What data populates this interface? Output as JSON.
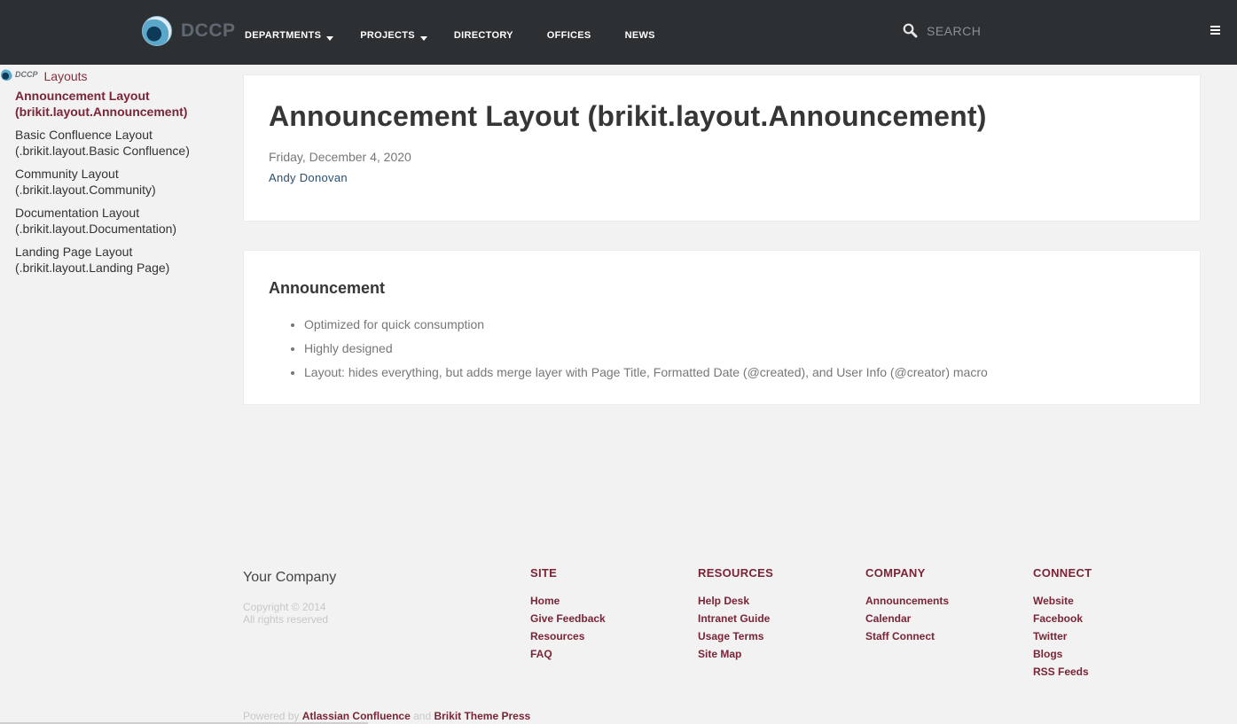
{
  "topbar": {
    "brand": "DCCP",
    "nav": [
      {
        "label": "DEPARTMENTS",
        "dropdown": true
      },
      {
        "label": "PROJECTS",
        "dropdown": true
      },
      {
        "label": "DIRECTORY",
        "dropdown": false
      },
      {
        "label": "OFFICES",
        "dropdown": false
      },
      {
        "label": "NEWS",
        "dropdown": false
      }
    ],
    "search_placeholder": "SEARCH"
  },
  "sidebar": {
    "brand": "DCCP",
    "title": "Layouts",
    "items": [
      {
        "label": "Announcement Layout (brikit.layout.Announcement)",
        "active": true
      },
      {
        "label": "Basic Confluence Layout (.brikit.layout.Basic Confluence)",
        "active": false
      },
      {
        "label": "Community Layout (.brikit.layout.Community)",
        "active": false
      },
      {
        "label": "Documentation Layout (.brikit.layout.Documentation)",
        "active": false
      },
      {
        "label": "Landing Page Layout (.brikit.layout.Landing Page)",
        "active": false
      }
    ]
  },
  "page": {
    "title": "Announcement Layout (brikit.layout.Announcement)",
    "date": "Friday, December 4, 2020",
    "author": "Andy Donovan"
  },
  "content": {
    "heading": "Announcement",
    "bullets": [
      "Optimized for quick consumption",
      "Highly designed",
      "Layout: hides everything, but adds merge layer with Page Title, Formatted Date (@created), and User Info (@creator) macro"
    ]
  },
  "footer": {
    "company": "Your Company",
    "copyright_line1": "Copyright © 2014",
    "copyright_line2": "All rights reserved",
    "columns": [
      {
        "title": "SITE",
        "links": [
          "Home",
          "Give Feedback",
          "Resources",
          "FAQ"
        ]
      },
      {
        "title": "RESOURCES",
        "links": [
          "Help Desk",
          "Intranet Guide",
          "Usage Terms",
          "Site Map"
        ]
      },
      {
        "title": "COMPANY",
        "links": [
          "Announcements",
          "Calendar",
          "Staff Connect"
        ]
      },
      {
        "title": "CONNECT",
        "links": [
          "Website",
          "Facebook",
          "Twitter",
          "Blogs",
          "RSS Feeds"
        ]
      }
    ],
    "powered_prefix": "Powered by",
    "powered_link1": "Atlassian Confluence",
    "powered_and": "and",
    "powered_link2": "Brikit Theme Press"
  },
  "colors": {
    "topbar": "#2d3033",
    "accent": "#7a2436",
    "author_link": "#2a4f6e",
    "background": "#f2f2f2"
  },
  "icons": [
    "dccp-logo",
    "search-icon",
    "hamburger-menu-icon",
    "caret-down-icon"
  ]
}
